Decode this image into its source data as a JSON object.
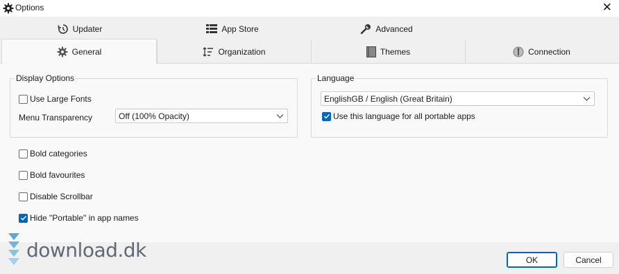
{
  "window": {
    "title": "Options",
    "close_glyph": "✕"
  },
  "tabs": {
    "row1": [
      {
        "label": "Updater",
        "icon": "history-clock-icon"
      },
      {
        "label": "App Store",
        "icon": "list-grid-icon"
      },
      {
        "label": "Advanced",
        "icon": "wrench-icon"
      }
    ],
    "row2": [
      {
        "label": "General",
        "icon": "gear-icon",
        "active": true
      },
      {
        "label": "Organization",
        "icon": "sort-lines-icon"
      },
      {
        "label": "Themes",
        "icon": "themes-book-icon"
      },
      {
        "label": "Connection",
        "icon": "connection-globe-icon"
      }
    ]
  },
  "general": {
    "display_options": {
      "title": "Display Options",
      "use_large_fonts": {
        "label": "Use Large Fonts",
        "checked": false
      },
      "menu_transparency": {
        "label": "Menu Transparency",
        "value": "Off (100% Opacity)"
      }
    },
    "language": {
      "title": "Language",
      "selected": "EnglishGB / English (Great Britain)",
      "use_for_all": {
        "label": "Use this language for all portable apps",
        "checked": true
      }
    },
    "options": [
      {
        "label": "Bold categories",
        "checked": false
      },
      {
        "label": "Bold favourites",
        "checked": false
      },
      {
        "label": "Disable Scrollbar",
        "checked": false
      },
      {
        "label": "Hide \"Portable\" in app names",
        "checked": true
      }
    ]
  },
  "footer": {
    "ok_label": "OK",
    "cancel_label": "Cancel"
  },
  "watermark": {
    "text": "download.dk"
  },
  "colors": {
    "accent": "#0067c0",
    "panel": "#f9f9f9",
    "chrome": "#f0f0f0"
  }
}
